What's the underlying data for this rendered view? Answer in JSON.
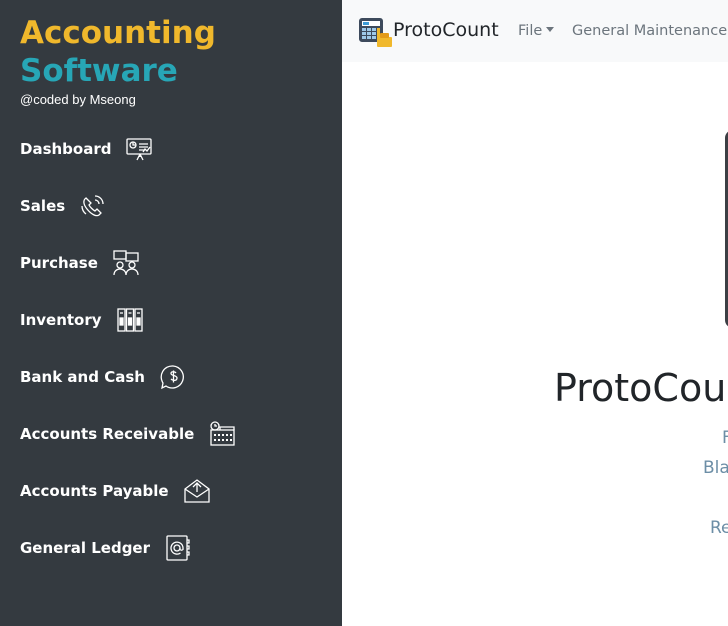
{
  "sidebar": {
    "brand": {
      "line1": "Accounting",
      "line2": "Software",
      "credit": "@coded by Mseong"
    },
    "items": [
      {
        "label": "Dashboard",
        "icon": "dashboard-presentation-icon"
      },
      {
        "label": "Sales",
        "icon": "phone-icon"
      },
      {
        "label": "Purchase",
        "icon": "meeting-people-icon"
      },
      {
        "label": "Inventory",
        "icon": "inventory-boxes-icon"
      },
      {
        "label": "Bank and Cash",
        "icon": "dollar-chat-icon"
      },
      {
        "label": "Accounts Receivable",
        "icon": "calendar-clock-icon"
      },
      {
        "label": "Accounts Payable",
        "icon": "envelope-upload-icon"
      },
      {
        "label": "General Ledger",
        "icon": "address-book-icon"
      }
    ]
  },
  "topbar": {
    "app_name": "ProtoCount",
    "menu": [
      {
        "label": "File"
      },
      {
        "label": "General Maintenance"
      }
    ]
  },
  "main": {
    "hero_title": "ProtoCou",
    "line_a": "F",
    "line_b": "Bla",
    "line_c": "Re"
  },
  "colors": {
    "sidebar_bg": "#343a40",
    "brand_yellow": "#f0b82c",
    "brand_teal": "#27a6b6",
    "topbar_bg": "#f8f9fa",
    "muted_link": "#6c8ea6"
  }
}
